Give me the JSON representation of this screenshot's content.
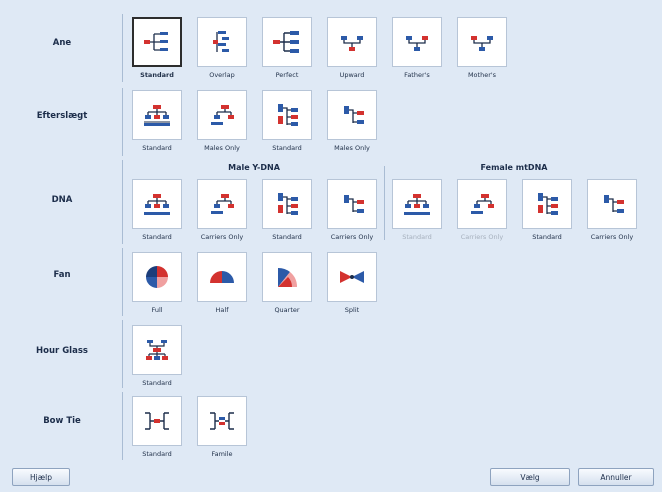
{
  "rows": {
    "ane": "Ane",
    "efterslaegt": "Efterslægt",
    "dna": "DNA",
    "fan": "Fan",
    "hourglass": "Hour Glass",
    "bowtie": "Bow Tie"
  },
  "ane_tiles": [
    "Standard",
    "Overlap",
    "Perfect",
    "Upward",
    "Father's",
    "Mother's"
  ],
  "eft_tiles": [
    "Standard",
    "Males Only",
    "Standard",
    "Males Only"
  ],
  "dna": {
    "male_header": "Male Y-DNA",
    "female_header": "Female mtDNA",
    "tiles": [
      "Standard",
      "Carriers Only",
      "Standard",
      "Carriers Only",
      "Standard",
      "Carriers Only",
      "Standard",
      "Carriers Only"
    ]
  },
  "fan_tiles": [
    "Full",
    "Half",
    "Quarter",
    "Split"
  ],
  "hourglass_tiles": [
    "Standard"
  ],
  "bowtie_tiles": [
    "Standard",
    "Famile"
  ],
  "buttons": {
    "help": "Hjælp",
    "select": "Vælg",
    "cancel": "Annuller"
  },
  "colors": {
    "accent_red": "#d3322f",
    "accent_blue": "#2c5aa8",
    "background": "#dfe9f5"
  }
}
